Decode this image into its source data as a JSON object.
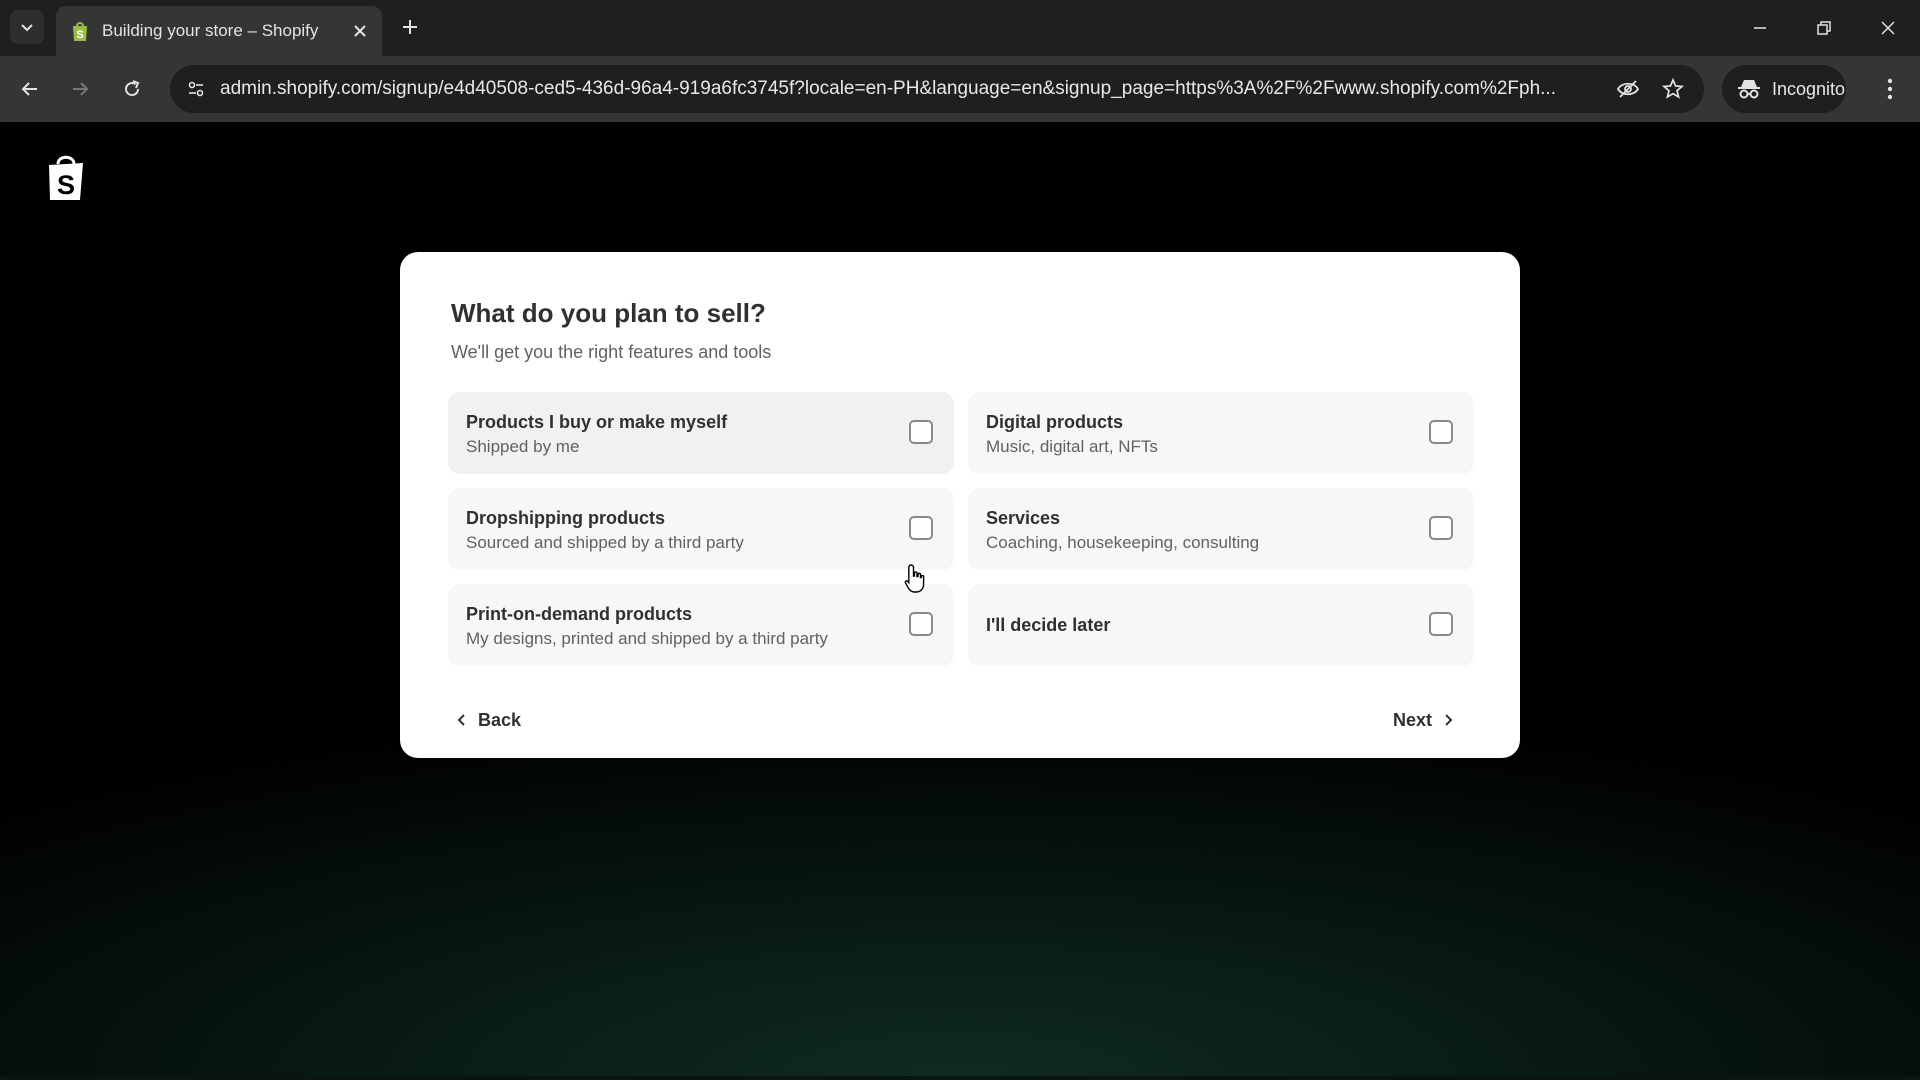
{
  "browser": {
    "tab": {
      "title": "Building your store – Shopify",
      "favicon": "shopify-bag-icon"
    },
    "url": "admin.shopify.com/signup/e4d40508-ced5-436d-96a4-919a6fc3745f?locale=en-PH&language=en&signup_page=https%3A%2F%2Fwww.shopify.com%2Fph...",
    "incognito_label": "Incognito"
  },
  "colors": {
    "chrome_dark": "#1f1f1f",
    "chrome_toolbar": "#353535",
    "shopify_green": "#95bf47",
    "card_bg": "#ffffff",
    "text_primary": "#303030",
    "text_secondary": "#616161"
  },
  "question": {
    "title": "What do you plan to sell?",
    "subtitle": "We'll get you the right features and tools"
  },
  "options": [
    {
      "title": "Products I buy or make myself",
      "desc": "Shipped by me",
      "checked": false
    },
    {
      "title": "Digital products",
      "desc": "Music, digital art, NFTs",
      "checked": false
    },
    {
      "title": "Dropshipping products",
      "desc": "Sourced and shipped by a third party",
      "checked": false
    },
    {
      "title": "Services",
      "desc": "Coaching, housekeeping, consulting",
      "checked": false
    },
    {
      "title": "Print-on-demand products",
      "desc": "My designs, printed and shipped by a third party",
      "checked": false
    },
    {
      "title": "I'll decide later",
      "checked": false
    }
  ],
  "nav": {
    "back_label": "Back",
    "next_label": "Next"
  }
}
